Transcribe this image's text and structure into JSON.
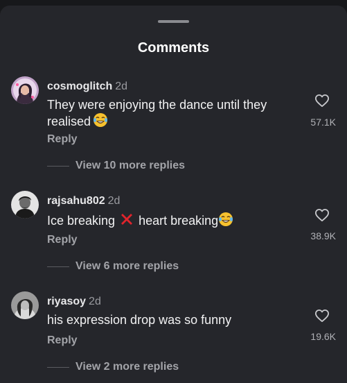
{
  "header": {
    "title": "Comments"
  },
  "comments": [
    {
      "username": "cosmoglitch",
      "time": "2d",
      "text": "They were enjoying the dance until they realised",
      "emoji": "laughing-tears",
      "reply_label": "Reply",
      "likes": "57.1K",
      "more_replies": "View 10 more replies"
    },
    {
      "username": "rajsahu802",
      "time": "2d",
      "text_before": "Ice breaking",
      "text_after": "heart breaking",
      "emoji": "laughing-tears",
      "reply_label": "Reply",
      "likes": "38.9K",
      "more_replies": "View 6 more replies"
    },
    {
      "username": "riyasoy",
      "time": "2d",
      "text": "his expression drop was so funny",
      "reply_label": "Reply",
      "likes": "19.6K",
      "more_replies": "View 2 more replies"
    }
  ],
  "colors": {
    "sheet_bg": "#25262b",
    "text_primary": "#f2f2f3",
    "text_secondary": "#a3a4a9",
    "cross_red": "#e0242c"
  }
}
